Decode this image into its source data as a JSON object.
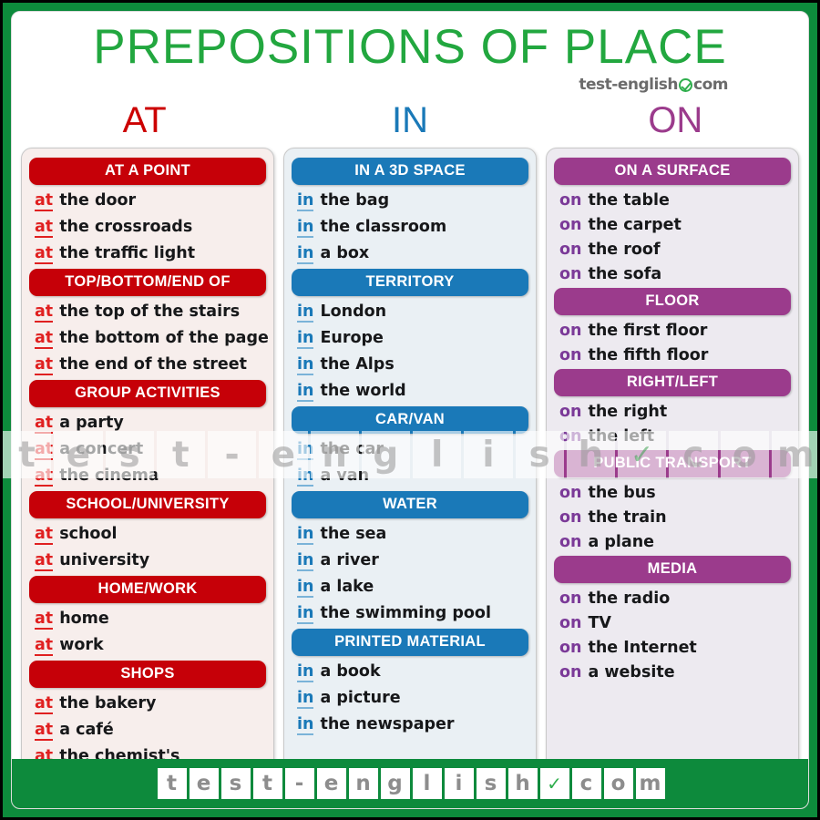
{
  "header": {
    "title": "PREPOSITIONS OF PLACE",
    "brand_prefix": "test-english",
    "brand_check_icon": "check-circle-icon",
    "brand_suffix": "com"
  },
  "colors": {
    "title_green": "#22a73f",
    "border_green": "#0d8a3c",
    "at_red": "#c60008",
    "in_blue": "#1a79b8",
    "on_purple": "#9b3b8c",
    "at_card_bg": "#f7eeec",
    "in_card_bg": "#eaf0f4",
    "on_card_bg": "#edeaf0"
  },
  "columns": [
    {
      "key": "at",
      "label": "AT",
      "sections": [
        {
          "heading": "AT A POINT",
          "items": [
            {
              "prep": "at",
              "text": "the door"
            },
            {
              "prep": "at",
              "text": "the crossroads"
            },
            {
              "prep": "at",
              "text": "the traffic light"
            }
          ]
        },
        {
          "heading": "TOP/BOTTOM/END OF",
          "items": [
            {
              "prep": "at",
              "text": "the top  of the stairs"
            },
            {
              "prep": "at",
              "text": "the bottom of the page"
            },
            {
              "prep": "at",
              "text": "the end of the street"
            }
          ]
        },
        {
          "heading": "GROUP ACTIVITIES",
          "items": [
            {
              "prep": "at",
              "text": "a party"
            },
            {
              "prep": "at",
              "text": "a concert"
            },
            {
              "prep": "at",
              "text": "the cinema"
            }
          ]
        },
        {
          "heading": "SCHOOL/UNIVERSITY",
          "items": [
            {
              "prep": "at",
              "text": "school"
            },
            {
              "prep": "at",
              "text": "university"
            }
          ]
        },
        {
          "heading": "HOME/WORK",
          "items": [
            {
              "prep": "at",
              "text": "home"
            },
            {
              "prep": "at",
              "text": "work"
            }
          ]
        },
        {
          "heading": "SHOPS",
          "items": [
            {
              "prep": "at",
              "text": "the bakery"
            },
            {
              "prep": "at",
              "text": "a café"
            },
            {
              "prep": "at",
              "text": "the chemist's"
            }
          ]
        }
      ]
    },
    {
      "key": "in",
      "label": "IN",
      "sections": [
        {
          "heading": "IN A 3D SPACE",
          "items": [
            {
              "prep": "in",
              "text": "the bag"
            },
            {
              "prep": "in",
              "text": "the classroom"
            },
            {
              "prep": "in",
              "text": "a box"
            }
          ]
        },
        {
          "heading": "TERRITORY",
          "items": [
            {
              "prep": "in",
              "text": "London"
            },
            {
              "prep": "in",
              "text": "Europe"
            },
            {
              "prep": "in",
              "text": "the Alps"
            },
            {
              "prep": "in",
              "text": "the world"
            }
          ]
        },
        {
          "heading": "CAR/VAN",
          "items": [
            {
              "prep": "in",
              "text": "the car"
            },
            {
              "prep": "in",
              "text": "a van"
            }
          ]
        },
        {
          "heading": "WATER",
          "items": [
            {
              "prep": "in",
              "text": "the sea"
            },
            {
              "prep": "in",
              "text": "a river"
            },
            {
              "prep": "in",
              "text": "a lake"
            },
            {
              "prep": "in",
              "text": "the swimming pool"
            }
          ]
        },
        {
          "heading": "PRINTED MATERIAL",
          "items": [
            {
              "prep": "in",
              "text": "a book"
            },
            {
              "prep": "in",
              "text": "a picture"
            },
            {
              "prep": "in",
              "text": "the newspaper"
            }
          ]
        }
      ]
    },
    {
      "key": "on",
      "label": "ON",
      "sections": [
        {
          "heading": "ON A SURFACE",
          "items": [
            {
              "prep": "on",
              "text": "the table"
            },
            {
              "prep": "on",
              "text": "the carpet"
            },
            {
              "prep": "on",
              "text": "the roof"
            },
            {
              "prep": "on",
              "text": "the sofa"
            }
          ]
        },
        {
          "heading": "FLOOR",
          "items": [
            {
              "prep": "on",
              "text": "the first floor"
            },
            {
              "prep": "on",
              "text": "the fifth floor"
            }
          ]
        },
        {
          "heading": "RIGHT/LEFT",
          "items": [
            {
              "prep": "on",
              "text": "the right"
            },
            {
              "prep": "on",
              "text": "the left"
            }
          ]
        },
        {
          "heading": "PUBLIC TRANSPORT",
          "items": [
            {
              "prep": "on",
              "text": "the bus"
            },
            {
              "prep": "on",
              "text": "the train"
            },
            {
              "prep": "on",
              "text": "a plane"
            }
          ]
        },
        {
          "heading": "MEDIA",
          "items": [
            {
              "prep": "on",
              "text": "the radio"
            },
            {
              "prep": "on",
              "text": "TV"
            },
            {
              "prep": "on",
              "text": "the Internet"
            },
            {
              "prep": "on",
              "text": "a website"
            }
          ]
        }
      ]
    }
  ],
  "watermark": {
    "cells": [
      "t",
      "e",
      "s",
      "t",
      "-",
      "e",
      "n",
      "g",
      "l",
      "i",
      "s",
      "h",
      "✓",
      "c",
      "o",
      "m"
    ],
    "check_index": 12
  },
  "footer": {
    "cells": [
      "t",
      "e",
      "s",
      "t",
      "-",
      "e",
      "n",
      "g",
      "l",
      "i",
      "s",
      "h",
      "✓",
      "c",
      "o",
      "m"
    ],
    "check_index": 12
  }
}
